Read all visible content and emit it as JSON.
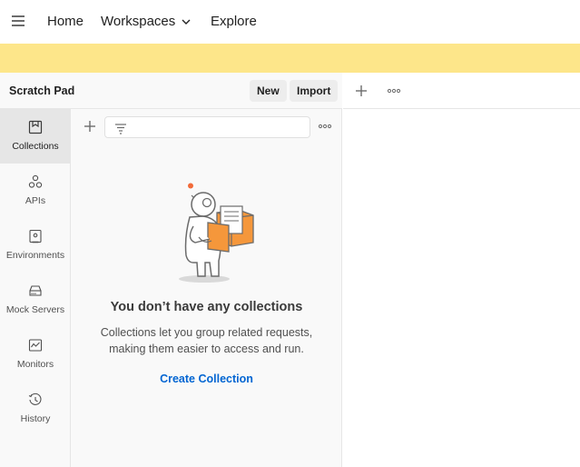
{
  "topnav": {
    "home": "Home",
    "workspaces": "Workspaces",
    "explore": "Explore"
  },
  "panel": {
    "title": "Scratch Pad",
    "new_label": "New",
    "import_label": "Import"
  },
  "rail": {
    "items": [
      {
        "label": "Collections",
        "icon": "collections-icon",
        "active": true
      },
      {
        "label": "APIs",
        "icon": "apis-icon",
        "active": false
      },
      {
        "label": "Environments",
        "icon": "environments-icon",
        "active": false
      },
      {
        "label": "Mock Servers",
        "icon": "mock-servers-icon",
        "active": false
      },
      {
        "label": "Monitors",
        "icon": "monitors-icon",
        "active": false
      },
      {
        "label": "History",
        "icon": "history-icon",
        "active": false
      }
    ]
  },
  "collections": {
    "empty_title": "You don’t have any collections",
    "empty_desc_line1": "Collections let you group related requests,",
    "empty_desc_line2": "making them easier to access and run.",
    "create_label": "Create Collection"
  },
  "colors": {
    "banner": "#fde68a",
    "link": "#0265d2",
    "illustration_accent": "#f5973b"
  }
}
